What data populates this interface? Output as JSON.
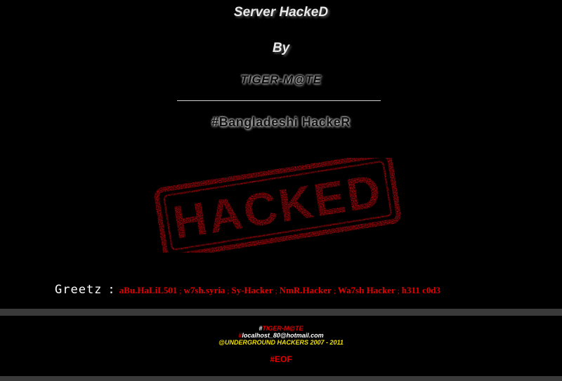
{
  "header": {
    "title": "Server HackeD",
    "by": "By",
    "author": "TIGER-M@TE",
    "tagline": "#Bangladeshi HackeR"
  },
  "stamp": {
    "text": "HACKED",
    "color": "#d10a0f"
  },
  "greetz": {
    "label": "Greetz",
    "colon": ":",
    "separator": ";",
    "names": [
      "aBu.HaLiL501",
      "w7sh.syria",
      "Sy-Hacker",
      "NmR.Hacker",
      "Wa7sh Hacker",
      "h311 c0d3"
    ]
  },
  "footer": {
    "hash": "#",
    "team": "TIGER-M@TE",
    "email_hash": "#",
    "email": "localhost_80@hotmail.com",
    "copyright": "@UNDERGROUND HACKERS 2007 - 2011",
    "eof": "#EOF"
  },
  "colors": {
    "background": "#000000",
    "accent_red": "#e00000",
    "copyright_yellow": "#f0e000",
    "band_gray": "#3a3a3a"
  }
}
